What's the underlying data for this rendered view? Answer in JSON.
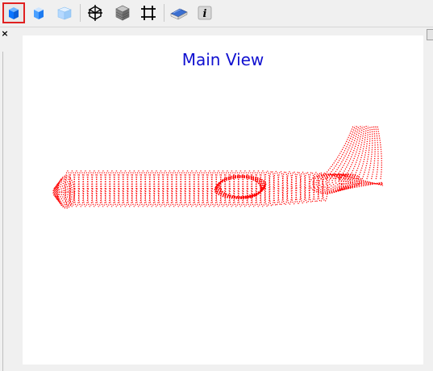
{
  "toolbar": {
    "buttons": [
      {
        "name": "view-solid-button",
        "icon": "solid-cube-icon",
        "active": true
      },
      {
        "name": "view-shaded-button",
        "icon": "shaded-cube-icon",
        "active": false
      },
      {
        "name": "view-transparent-button",
        "icon": "transparent-cube-icon",
        "active": false
      },
      {
        "name": "view-wireframe-button",
        "icon": "wireframe-cube-icon",
        "active": false
      },
      {
        "name": "view-mesh-button",
        "icon": "mesh-cube-icon",
        "active": false
      },
      {
        "name": "view-frame-button",
        "icon": "frame-icon",
        "active": false
      },
      {
        "name": "help-book-button",
        "icon": "book-icon",
        "active": false
      },
      {
        "name": "info-button",
        "icon": "info-icon",
        "active": false
      }
    ],
    "close_label": "×"
  },
  "viewport": {
    "title": "Main View",
    "title_color": "#1010d0",
    "model_color": "#ff0000"
  }
}
